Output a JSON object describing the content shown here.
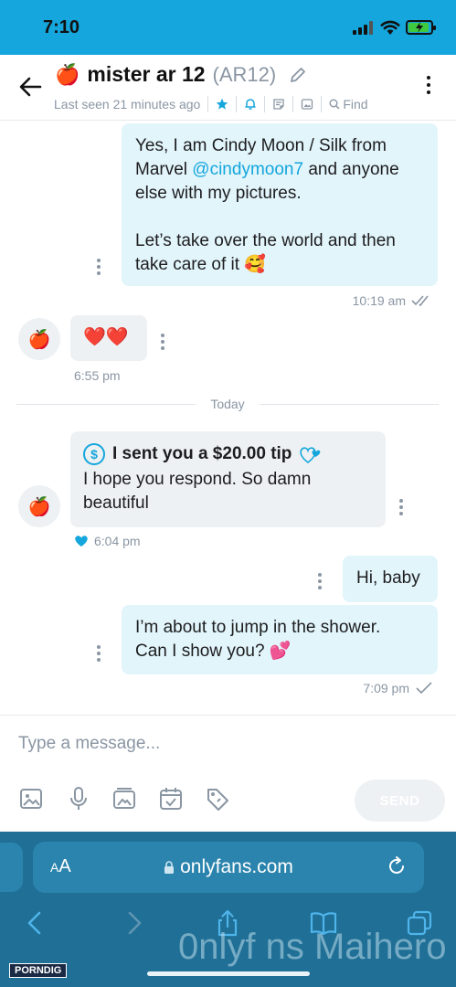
{
  "status_bar": {
    "time": "7:10"
  },
  "header": {
    "emoji": "🍎",
    "name": "mister ar 12",
    "handle": "(AR12)",
    "last_seen": "Last seen 21 minutes ago",
    "find_label": "Find"
  },
  "messages": {
    "m1": {
      "para1_text": "Yes, I am Cindy Moon / Silk from Marvel",
      "mention": "@cindymoon7",
      "para1_tail": "and anyone else with my pictures.",
      "para2": "Let’s take over the world and then take care of it 🥰",
      "time": "10:19 am"
    },
    "m2": {
      "text": "❤️❤️",
      "time": "6:55 pm"
    },
    "divider": "Today",
    "m3": {
      "tip": "I sent you a $20.00 tip",
      "text": "I hope you respond. So damn beautiful",
      "time": "6:04 pm"
    },
    "m4": {
      "text": "Hi, baby"
    },
    "m5": {
      "text": "I’m about to jump in the shower. Can I show you? 💕",
      "time": "7:09 pm"
    }
  },
  "composer": {
    "placeholder": "Type a message...",
    "send_label": "SEND"
  },
  "browser": {
    "aa_small": "A",
    "aa_large": "A",
    "url": "onlyfans.com"
  },
  "overlay": {
    "watermark": "0nlyf ns Maihero",
    "logo": "PORNDIG"
  },
  "colors": {
    "accent": "#14a6dc",
    "status_bar": "#14a6dc",
    "browser_bar": "#1f6f96"
  }
}
